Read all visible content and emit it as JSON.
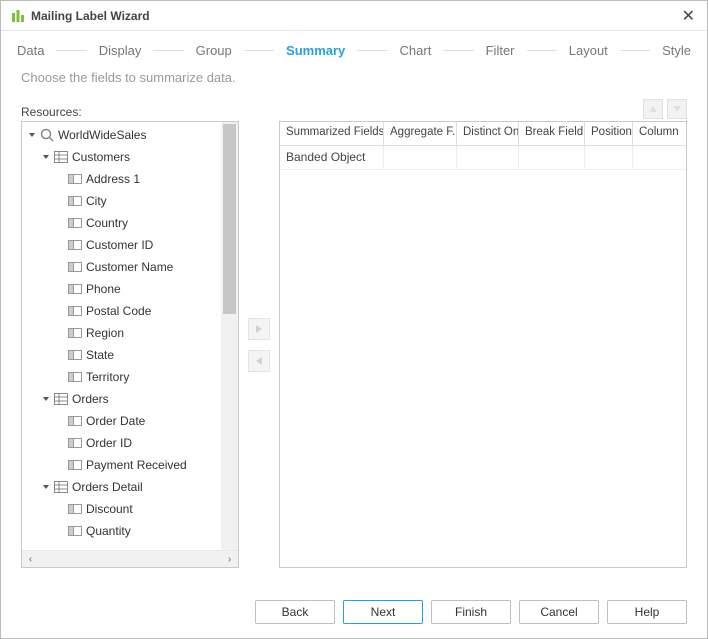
{
  "window": {
    "title": "Mailing Label Wizard"
  },
  "steps": [
    "Data",
    "Display",
    "Group",
    "Summary",
    "Chart",
    "Filter",
    "Layout",
    "Style"
  ],
  "activeStep": "Summary",
  "subtitle": "Choose the fields to summarize data.",
  "resourcesLabel": "Resources:",
  "tree": {
    "root": "WorldWideSales",
    "groups": [
      {
        "name": "Customers",
        "fields": [
          "Address 1",
          "City",
          "Country",
          "Customer ID",
          "Customer Name",
          "Phone",
          "Postal Code",
          "Region",
          "State",
          "Territory"
        ]
      },
      {
        "name": "Orders",
        "fields": [
          "Order Date",
          "Order ID",
          "Payment Received"
        ]
      },
      {
        "name": "Orders Detail",
        "fields": [
          "Discount",
          "Quantity"
        ]
      }
    ]
  },
  "table": {
    "headers": [
      "Summarized Fields",
      "Aggregate F...",
      "Distinct On",
      "Break Field",
      "Position",
      "Column"
    ],
    "rows": [
      {
        "summarized": "Banded Object"
      }
    ]
  },
  "buttons": {
    "back": "Back",
    "next": "Next",
    "finish": "Finish",
    "cancel": "Cancel",
    "help": "Help"
  }
}
